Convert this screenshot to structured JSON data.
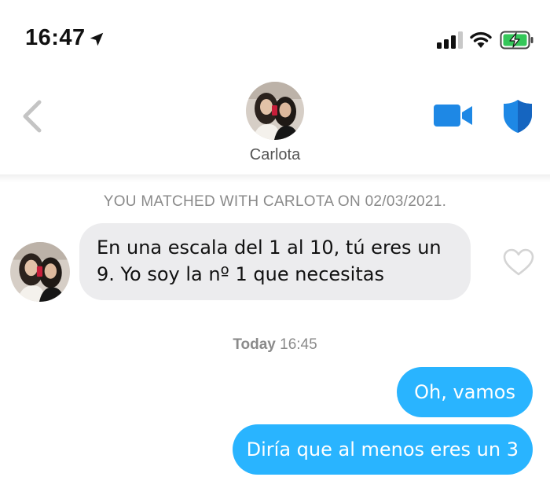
{
  "status_bar": {
    "time": "16:47",
    "icons": [
      "location-arrow-icon",
      "cellular-signal-icon",
      "wifi-icon",
      "battery-charging-icon"
    ]
  },
  "header": {
    "back_icon": "chevron-left-icon",
    "contact_name": "Carlota",
    "video_icon": "video-camera-icon",
    "shield_icon": "shield-icon"
  },
  "match_banner": "YOU MATCHED WITH CARLOTA ON 02/03/2021.",
  "messages": {
    "incoming": [
      {
        "text": "En una escala del 1 al 10, tú eres un 9. Yo soy la nº 1 que necesitas"
      }
    ],
    "timestamp": {
      "day": "Today",
      "time": "16:45"
    },
    "outgoing": [
      {
        "text": "Oh, vamos"
      },
      {
        "text": "Diría que al menos eres un 3"
      }
    ]
  },
  "colors": {
    "accent_blue": "#1E88E5",
    "outgoing_bubble": "#29B4FF",
    "incoming_bubble": "#ECECEE",
    "battery_green": "#34C759",
    "muted_text": "#8A8A8A"
  }
}
